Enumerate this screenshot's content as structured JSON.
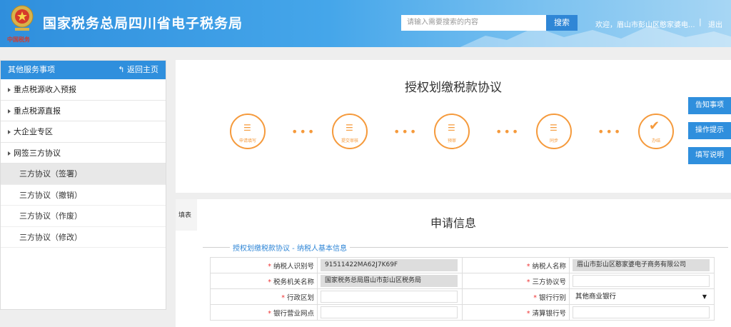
{
  "header": {
    "title": "国家税务总局四川省电子税务局",
    "emblem_caption": "中国税务",
    "search_placeholder": "请输入需要搜索的内容",
    "search_label": "搜索",
    "welcome": "欢迎，眉山市彭山区憨家婆电...",
    "separator": "|",
    "logout": "退出"
  },
  "sidebar": {
    "heading": "其他服务事项",
    "back": "返回主页",
    "items": [
      {
        "label": "重点税源收入预报"
      },
      {
        "label": "重点税源直报"
      },
      {
        "label": "大企业专区"
      },
      {
        "label": "网签三方协议"
      }
    ],
    "subitems": [
      {
        "label": "三方协议（签署）"
      },
      {
        "label": "三方协议（撤销）"
      },
      {
        "label": "三方协议（作废）"
      },
      {
        "label": "三方协议（修改）"
      }
    ]
  },
  "agreement": {
    "title": "授权划缴税款协议",
    "steps": [
      {
        "label": "申请填写",
        "icon": "database-icon"
      },
      {
        "label": "提交审核",
        "icon": "database-icon"
      },
      {
        "label": "预审",
        "icon": "database-icon"
      },
      {
        "label": "同步",
        "icon": "database-icon"
      },
      {
        "label": "办结",
        "icon": "check-icon"
      }
    ],
    "dots": "•••"
  },
  "right_buttons": [
    {
      "label": "告知事项"
    },
    {
      "label": "操作提示"
    },
    {
      "label": "填写说明"
    }
  ],
  "form": {
    "tab": "填表",
    "title": "申请信息",
    "legend": "授权划缴税款协议 - 纳税人基本信息",
    "required_mark": "*",
    "rows": [
      {
        "l1": "纳税人识别号",
        "v1": "91511422MA62J7K69F",
        "l2": "纳税人名称",
        "v2": "眉山市彭山区憨家婆电子商务有限公司"
      },
      {
        "l1": "税务机关名称",
        "v1": "国家税务总局眉山市彭山区税务局",
        "l2": "三方协议号",
        "v2": ""
      },
      {
        "l1": "行政区划",
        "v1": "",
        "l2": "银行行别",
        "v2": "其他商业银行"
      },
      {
        "l1": "银行营业网点",
        "v1": "",
        "l2": "清算银行号",
        "v2": ""
      }
    ],
    "select_arrow": "▼"
  },
  "colors": {
    "primary": "#2f8fdd",
    "accent": "#f59a3c",
    "required": "#ee3333"
  }
}
